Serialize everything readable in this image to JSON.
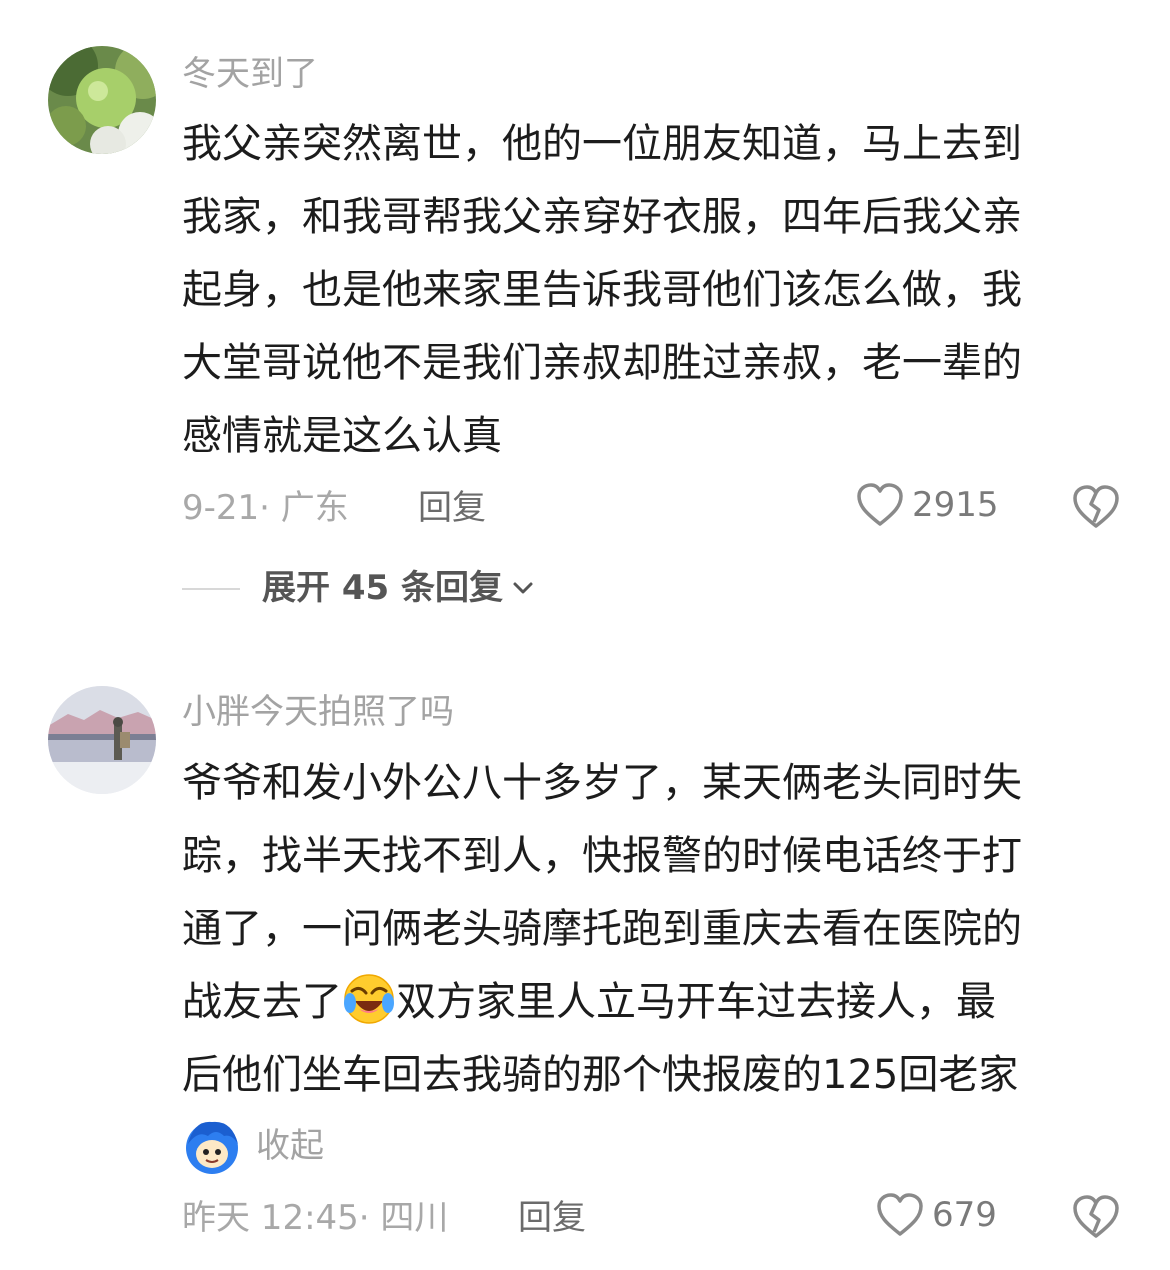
{
  "comments": [
    {
      "username": "冬天到了",
      "lines": [
        "我父亲突然离世，他的一位朋友知道，马上去到",
        "我家，和我哥帮我父亲穿好衣服，四年后我父亲",
        "起身，也是他来家里告诉我哥他们该怎么做，我",
        "大堂哥说他不是我们亲叔却胜过亲叔，老一辈的",
        "感情就是这么认真"
      ],
      "meta": "9-21· 广东",
      "reply_label": "回复",
      "like_count": "2915",
      "expand_label": "展开 45 条回复"
    },
    {
      "username": "小胖今天拍照了吗",
      "lines": [
        "爷爷和发小外公八十多岁了，某天俩老头同时失",
        "踪，找半天找不到人，快报警的时候电话终于打",
        "通了，一问俩老头骑摩托跑到重庆去看在医院的",
        "双方家里人立马开车过去接人，最",
        "后他们坐车回去我骑的那个快报废的125回老家"
      ],
      "line4_prefix": "战友去了",
      "collapse_label": "收起",
      "meta": "昨天 12:45· 四川",
      "reply_label": "回复",
      "like_count": "679"
    }
  ],
  "icons": {
    "heart": "heart-outline-icon",
    "dislike": "broken-heart-icon",
    "chevron": "chevron-down-icon",
    "emoji": "crying-laughing-emoji",
    "sticker": "blue-hair-sticker"
  },
  "colors": {
    "text": "#1c1c1c",
    "muted": "#a3a3a3",
    "reply": "#6b6b6b"
  }
}
